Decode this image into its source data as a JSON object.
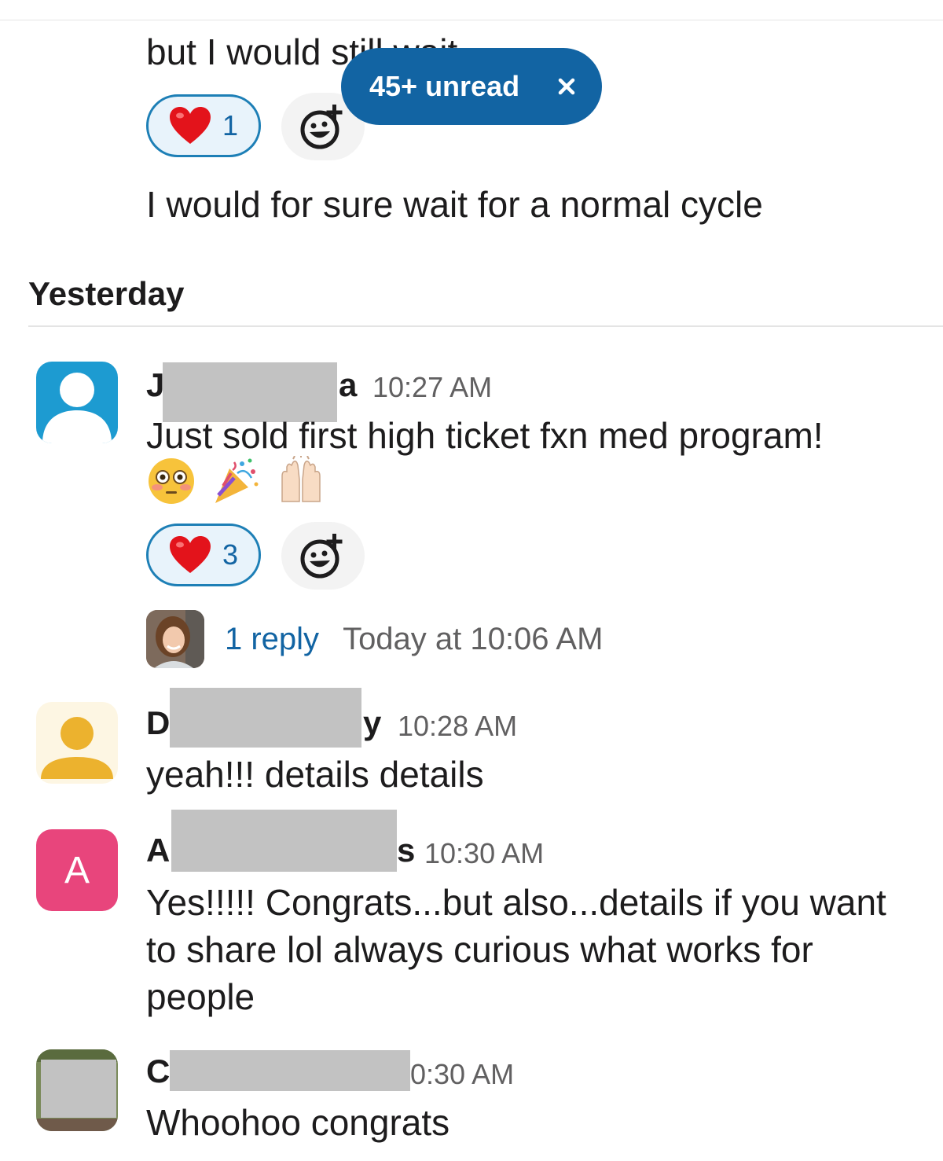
{
  "top_message": {
    "text_partial": "but I would still wait",
    "reaction": {
      "icon": "heart-emoji",
      "count": "1"
    },
    "followup": "I would for sure wait for a normal cycle"
  },
  "unread_banner": {
    "label": "45+ unread",
    "close_icon": "close-icon"
  },
  "day_divider": "Yesterday",
  "messages": [
    {
      "name_first": "J",
      "name_last": "a",
      "time": "10:27 AM",
      "text": "Just sold first high ticket fxn med program!",
      "emojis": [
        "flushed-face-emoji",
        "party-popper-emoji",
        "raised-hands-emoji"
      ],
      "reaction": {
        "icon": "heart-emoji",
        "count": "3"
      },
      "thread": {
        "replies": "1 reply",
        "last_reply": "Today at 10:06 AM"
      },
      "avatar": "default-user-avatar-blue"
    },
    {
      "name_first": "D",
      "name_last": "y",
      "time": "10:28 AM",
      "text": "yeah!!!  details details",
      "avatar": "default-user-avatar-yellow"
    },
    {
      "name_first": "A",
      "name_last": "s",
      "time": "10:30 AM",
      "avatar_letter": "A",
      "text": "Yes!!!!! Congrats...but also...details if you want to share lol always curious what works for people"
    },
    {
      "name_first": "C",
      "time": "0:30 AM",
      "text": "Whoohoo congrats",
      "avatar": "photo-avatar"
    }
  ],
  "colors": {
    "accent": "#1264a3",
    "reaction_border": "#1d7fb6",
    "avatar_blue": "#1d9bd1",
    "avatar_yellow": "#ecb22e",
    "avatar_pink": "#e8457c",
    "redaction": "#c2c2c2"
  }
}
